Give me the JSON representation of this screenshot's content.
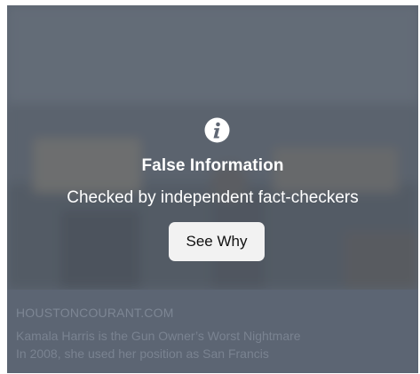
{
  "warning": {
    "icon": "info-icon",
    "title": "False Information",
    "subtitle": "Checked by independent fact-checkers",
    "button_label": "See Why"
  },
  "link_preview": {
    "domain": "HOUSTONCOURANT.COM",
    "title": "Kamala Harris is the Gun Owner’s Worst Nightmare",
    "description": "In 2008, she used her position as San Francis"
  },
  "colors": {
    "overlay": "#58606c",
    "button_bg": "#f2f2f2",
    "text_light": "#ffffff",
    "preview_text": "#7d8694"
  }
}
